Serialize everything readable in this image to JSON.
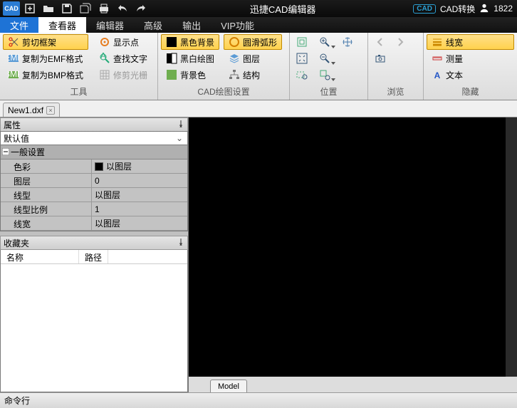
{
  "title": "迅捷CAD编辑器",
  "titlebar_right": {
    "badge": "CAD",
    "convert": "CAD转换",
    "count": "1822"
  },
  "menu": {
    "file": "文件",
    "tabs": [
      "查看器",
      "编辑器",
      "高级",
      "输出",
      "VIP功能"
    ],
    "active": 0
  },
  "ribbon": {
    "tools": {
      "title": "工具",
      "cut": "剪切框架",
      "emf": "复制为EMF格式",
      "bmp": "复制为BMP格式",
      "showpt": "显示点",
      "findtxt": "查找文字",
      "trimraster": "修剪光栅"
    },
    "cad": {
      "title": "CAD绘图设置",
      "blackbg": "黑色背景",
      "bwdraw": "黑白绘图",
      "bgcolor": "背景色",
      "smootharc": "圆滑弧形",
      "layer": "图层",
      "structure": "结构"
    },
    "pos": {
      "title": "位置"
    },
    "browse": {
      "title": "浏览"
    },
    "hide": {
      "title": "隐藏",
      "lw": "线宽",
      "measure": "测量",
      "text": "文本"
    }
  },
  "doc": {
    "tab": "New1.dxf"
  },
  "props": {
    "panel": "属性",
    "combo": "默认值",
    "section": "一般设置",
    "rows": [
      {
        "k": "色彩",
        "v": "以图层",
        "swatch": true
      },
      {
        "k": "图层",
        "v": "0"
      },
      {
        "k": "线型",
        "v": "以图层"
      },
      {
        "k": "线型比例",
        "v": "1"
      },
      {
        "k": "线宽",
        "v": "以图层"
      }
    ]
  },
  "fav": {
    "panel": "收藏夹",
    "col1": "名称",
    "col2": "路径"
  },
  "model_tab": "Model",
  "cmdline": "命令行"
}
